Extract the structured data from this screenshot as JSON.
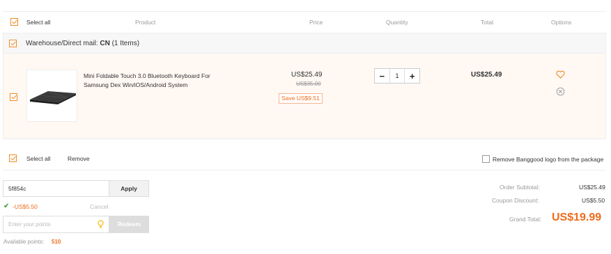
{
  "header": {
    "select_all": "Select all",
    "product": "Product",
    "price": "Price",
    "quantity": "Quantity",
    "total": "Total",
    "options": "Options"
  },
  "group": {
    "label": "Warehouse/Direct mail:",
    "origin": "CN",
    "count": "(1 Items)"
  },
  "item": {
    "title_line1": "Mini Foldable Touch 3.0 Bluetooth Keyboard For",
    "title_line2": "Samsung Dex Win/iOS/Android System",
    "price": "US$25.49",
    "old_price": "US$35.00",
    "save": "Save US$9.51",
    "quantity": "1",
    "total": "US$25.49",
    "minus": "−",
    "plus": "+"
  },
  "footer": {
    "select_all": "Select all",
    "remove": "Remove",
    "remove_logo": "Remove Banggood logo from the package"
  },
  "coupon": {
    "code": "5f854c",
    "apply": "Apply",
    "discount": "-US$5.50",
    "cancel": "Cancel"
  },
  "points": {
    "placeholder": "Enter your points",
    "redeem": "Redeem",
    "available_label": "Available points:",
    "available_value": "510"
  },
  "summary": {
    "subtotal_label": "Order Subtotal:",
    "subtotal": "US$25.49",
    "coupon_label": "Coupon Discount:",
    "coupon": "US$5.50",
    "grand_label": "Grand Total:",
    "grand": "US$19.99"
  },
  "colors": {
    "accent": "#f06b1a",
    "checkbox": "#f08a24"
  }
}
